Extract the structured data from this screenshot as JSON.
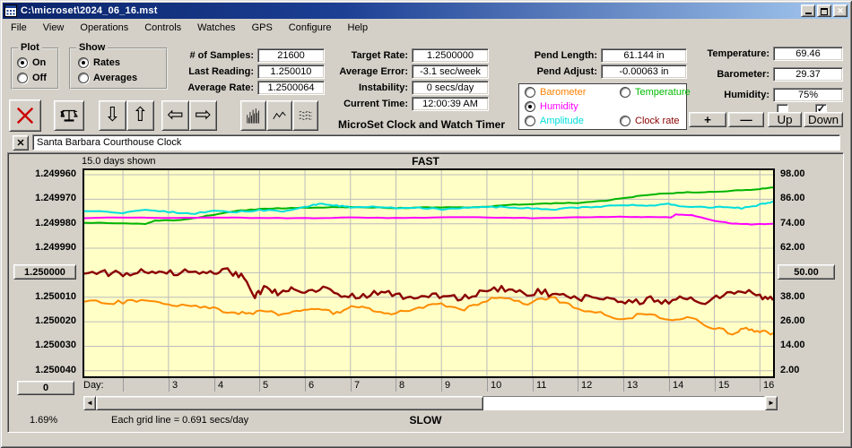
{
  "window": {
    "title": "C:\\microset\\2024_06_16.mst"
  },
  "menu": [
    "File",
    "View",
    "Operations",
    "Controls",
    "Watches",
    "GPS",
    "Configure",
    "Help"
  ],
  "plot_group": {
    "title": "Plot",
    "options": [
      {
        "label": "On",
        "selected": true
      },
      {
        "label": "Off",
        "selected": false
      }
    ]
  },
  "show_group": {
    "title": "Show",
    "options": [
      {
        "label": "Rates",
        "selected": true
      },
      {
        "label": "Averages",
        "selected": false
      }
    ]
  },
  "fields": {
    "samples": {
      "label": "# of Samples:",
      "value": "21600"
    },
    "last_reading": {
      "label": "Last Reading:",
      "value": "1.250010"
    },
    "average_rate": {
      "label": "Average Rate:",
      "value": "1.2500064"
    },
    "target_rate": {
      "label": "Target Rate:",
      "value": "1.2500000"
    },
    "average_error": {
      "label": "Average Error:",
      "value": "-3.1 sec/week"
    },
    "instability": {
      "label": "Instability:",
      "value": "0 secs/day"
    },
    "current_time": {
      "label": "Current Time:",
      "value": "12:00:39 AM"
    },
    "pend_length": {
      "label": "Pend Length:",
      "value": "61.144 in"
    },
    "pend_adjust": {
      "label": "Pend Adjust:",
      "value": "-0.00063 in"
    },
    "temperature": {
      "label": "Temperature:",
      "value": "69.46"
    },
    "barometer": {
      "label": "Barometer:",
      "value": "29.37"
    },
    "humidity": {
      "label": "Humidity:",
      "value": "75%"
    }
  },
  "app_name": "MicroSet Clock and Watch Timer",
  "legend": {
    "options": [
      {
        "label": "Barometer",
        "color": "#ff8000",
        "selected": false,
        "row": 1,
        "col": 1
      },
      {
        "label": "Temperature",
        "color": "#00bb00",
        "selected": false,
        "row": 1,
        "col": 2
      },
      {
        "label": "Humidity",
        "color": "#ff00ff",
        "selected": true,
        "row": 2,
        "col": 1
      },
      {
        "label": "Amplitude",
        "color": "#00dddd",
        "selected": false,
        "row": 3,
        "col": 1
      },
      {
        "label": "Clock rate",
        "color": "#8b0000",
        "selected": false,
        "row": 3,
        "col": 2
      }
    ]
  },
  "checkboxes": [
    {
      "checked": false
    },
    {
      "checked": true
    }
  ],
  "adjust_buttons": {
    "plus": "+",
    "minus": "—",
    "up": "Up",
    "down": "Down"
  },
  "clock_name": "Santa Barbara Courthouse Clock",
  "chart_header": {
    "days_shown": "15.0 days shown",
    "fast_label": "FAST",
    "slow_label": "SLOW",
    "day_label": "Day:",
    "zero_button": "0",
    "zoom_percent": "1.69%",
    "grid_note": "Each grid line = 0.691 secs/day"
  },
  "chart_data": {
    "type": "line",
    "x_range": [
      1.15,
      16.29
    ],
    "x_ticks": [
      3,
      4,
      5,
      6,
      7,
      8,
      9,
      10,
      11,
      12,
      13,
      14,
      15,
      16
    ],
    "left_axis": {
      "ticks": [
        "1.249960",
        "1.249970",
        "1.249980",
        "1.249990",
        "1.250000",
        "1.250010",
        "1.250020",
        "1.250030",
        "1.250040"
      ],
      "button_tick": "1.250000",
      "top_label": "FAST",
      "bottom_label": "SLOW"
    },
    "right_axis": {
      "ticks": [
        "98.00",
        "86.00",
        "74.00",
        "62.00",
        "50.00",
        "38.00",
        "26.00",
        "14.00",
        "2.00"
      ],
      "button_tick": "50.00"
    },
    "background": "#ffffc6",
    "grid_color": "#bcbcbc",
    "series": [
      {
        "name": "Temperature",
        "color": "#00b400",
        "axis": "right",
        "width": 2,
        "noise": 0.18,
        "points": [
          [
            1.15,
            74.5
          ],
          [
            2,
            74.2
          ],
          [
            2.5,
            74.0
          ],
          [
            2.7,
            75.5
          ],
          [
            3.2,
            75.6
          ],
          [
            3.6,
            76.8
          ],
          [
            4,
            78.5
          ],
          [
            4.5,
            80.3
          ],
          [
            5,
            81.2
          ],
          [
            5.5,
            81.6
          ],
          [
            6,
            81.8
          ],
          [
            6.5,
            82.0
          ],
          [
            7,
            82.2
          ],
          [
            7.5,
            82.0
          ],
          [
            8,
            81.7
          ],
          [
            8.5,
            81.9
          ],
          [
            9,
            82.1
          ],
          [
            9.5,
            82.0
          ],
          [
            10,
            82.4
          ],
          [
            10.5,
            83.2
          ],
          [
            11,
            83.7
          ],
          [
            11.5,
            84.0
          ],
          [
            12,
            84.2
          ],
          [
            12.5,
            85.0
          ],
          [
            13,
            86.6
          ],
          [
            13.5,
            88.0
          ],
          [
            14,
            89.0
          ],
          [
            14.5,
            89.4
          ],
          [
            15,
            89.6
          ],
          [
            15.5,
            90.3
          ],
          [
            16,
            91.0
          ],
          [
            16.29,
            91.8
          ]
        ]
      },
      {
        "name": "Amplitude",
        "color": "#00dede",
        "axis": "right",
        "width": 2,
        "noise": 0.35,
        "points": [
          [
            1.15,
            80.2
          ],
          [
            2,
            79.4
          ],
          [
            2.5,
            80.6
          ],
          [
            3,
            79.8
          ],
          [
            3.5,
            78.9
          ],
          [
            4,
            80.2
          ],
          [
            4.5,
            79.8
          ],
          [
            5,
            80.6
          ],
          [
            5.5,
            80.2
          ],
          [
            6,
            82.3
          ],
          [
            6.3,
            83.7
          ],
          [
            6.7,
            82.9
          ],
          [
            7,
            82.1
          ],
          [
            7.5,
            82.4
          ],
          [
            8,
            81.6
          ],
          [
            8.5,
            82.0
          ],
          [
            9,
            81.1
          ],
          [
            9.5,
            82.0
          ],
          [
            10,
            82.4
          ],
          [
            10.5,
            82.0
          ],
          [
            11,
            81.6
          ],
          [
            11.5,
            81.1
          ],
          [
            12,
            82.0
          ],
          [
            12.5,
            82.4
          ],
          [
            13,
            83.3
          ],
          [
            13.5,
            82.9
          ],
          [
            14,
            83.7
          ],
          [
            14.3,
            82.5
          ],
          [
            14.8,
            82.0
          ],
          [
            15.2,
            82.4
          ],
          [
            15.6,
            81.6
          ],
          [
            16,
            83.3
          ],
          [
            16.29,
            85.0
          ]
        ]
      },
      {
        "name": "Humidity",
        "color": "#ff00ff",
        "axis": "right",
        "width": 2,
        "noise": 0.12,
        "points": [
          [
            1.15,
            76.7
          ],
          [
            2,
            77.1
          ],
          [
            3,
            76.7
          ],
          [
            4,
            77.1
          ],
          [
            5,
            76.8
          ],
          [
            6,
            76.7
          ],
          [
            7,
            77.1
          ],
          [
            8,
            76.8
          ],
          [
            9,
            77.1
          ],
          [
            10,
            77.1
          ],
          [
            11,
            76.8
          ],
          [
            12,
            77.1
          ],
          [
            12.8,
            77.5
          ],
          [
            13.4,
            77.3
          ],
          [
            14.05,
            77.1
          ],
          [
            14.15,
            78.6
          ],
          [
            14.5,
            78.2
          ],
          [
            15,
            75.5
          ],
          [
            15.4,
            74.1
          ],
          [
            15.8,
            73.7
          ],
          [
            16.29,
            74.0
          ]
        ]
      },
      {
        "name": "Barometer",
        "color": "#ff8c00",
        "axis": "right",
        "width": 2,
        "noise": 1.0,
        "points": [
          [
            1.15,
            35.8
          ],
          [
            1.8,
            35.3
          ],
          [
            2.3,
            36.2
          ],
          [
            2.8,
            35.0
          ],
          [
            3.3,
            34.4
          ],
          [
            3.8,
            33.0
          ],
          [
            4.3,
            31.0
          ],
          [
            4.7,
            29.8
          ],
          [
            5.1,
            31.5
          ],
          [
            5.5,
            29.4
          ],
          [
            5.9,
            30.8
          ],
          [
            6.3,
            32.6
          ],
          [
            6.7,
            30.2
          ],
          [
            7.1,
            33.4
          ],
          [
            7.5,
            31.2
          ],
          [
            7.9,
            29.6
          ],
          [
            8.4,
            32.4
          ],
          [
            8.9,
            34.8
          ],
          [
            9.4,
            31.6
          ],
          [
            9.9,
            36.0
          ],
          [
            10.4,
            38.0
          ],
          [
            10.9,
            34.8
          ],
          [
            11.4,
            38.2
          ],
          [
            11.9,
            33.0
          ],
          [
            12.5,
            30.2
          ],
          [
            13,
            27.2
          ],
          [
            13.5,
            30.4
          ],
          [
            14,
            26.0
          ],
          [
            14.4,
            28.2
          ],
          [
            14.9,
            23.6
          ],
          [
            15.4,
            20.4
          ],
          [
            15.7,
            22.8
          ],
          [
            16,
            21.4
          ],
          [
            16.29,
            20.4
          ]
        ]
      },
      {
        "name": "Clock rate",
        "color": "#8b0000",
        "axis": "left",
        "width": 2.4,
        "noise": 1.3e-06,
        "points": [
          [
            1.15,
            1.2500004
          ],
          [
            1.6,
            1.25
          ],
          [
            2.0,
            1.2500006
          ],
          [
            2.4,
            1.2499998
          ],
          [
            2.8,
            1.2500003
          ],
          [
            3.2,
            1.2499999
          ],
          [
            3.6,
            1.2499995
          ],
          [
            4.0,
            1.2500004
          ],
          [
            4.3,
            1.2499992
          ],
          [
            4.6,
            1.2500015
          ],
          [
            4.9,
            1.25001
          ],
          [
            5.1,
            1.2500062
          ],
          [
            5.4,
            1.2500082
          ],
          [
            5.7,
            1.250007
          ],
          [
            6.0,
            1.250008
          ],
          [
            6.4,
            1.2500068
          ],
          [
            6.8,
            1.2500088
          ],
          [
            7.2,
            1.2500098
          ],
          [
            7.6,
            1.250008
          ],
          [
            8.0,
            1.2500085
          ],
          [
            8.4,
            1.2500108
          ],
          [
            8.8,
            1.2500092
          ],
          [
            9.2,
            1.2500105
          ],
          [
            9.6,
            1.2500096
          ],
          [
            10.0,
            1.2500072
          ],
          [
            10.4,
            1.2500064
          ],
          [
            10.8,
            1.2500086
          ],
          [
            11.2,
            1.2500076
          ],
          [
            11.6,
            1.2500096
          ],
          [
            12.0,
            1.2500108
          ],
          [
            12.4,
            1.250009
          ],
          [
            12.8,
            1.2500116
          ],
          [
            13.2,
            1.2500124
          ],
          [
            13.6,
            1.2500106
          ],
          [
            14.0,
            1.2500124
          ],
          [
            14.4,
            1.25001
          ],
          [
            14.8,
            1.2500118
          ],
          [
            15.2,
            1.2500092
          ],
          [
            15.6,
            1.2500072
          ],
          [
            16.0,
            1.25001
          ],
          [
            16.29,
            1.2500112
          ]
        ]
      }
    ]
  }
}
